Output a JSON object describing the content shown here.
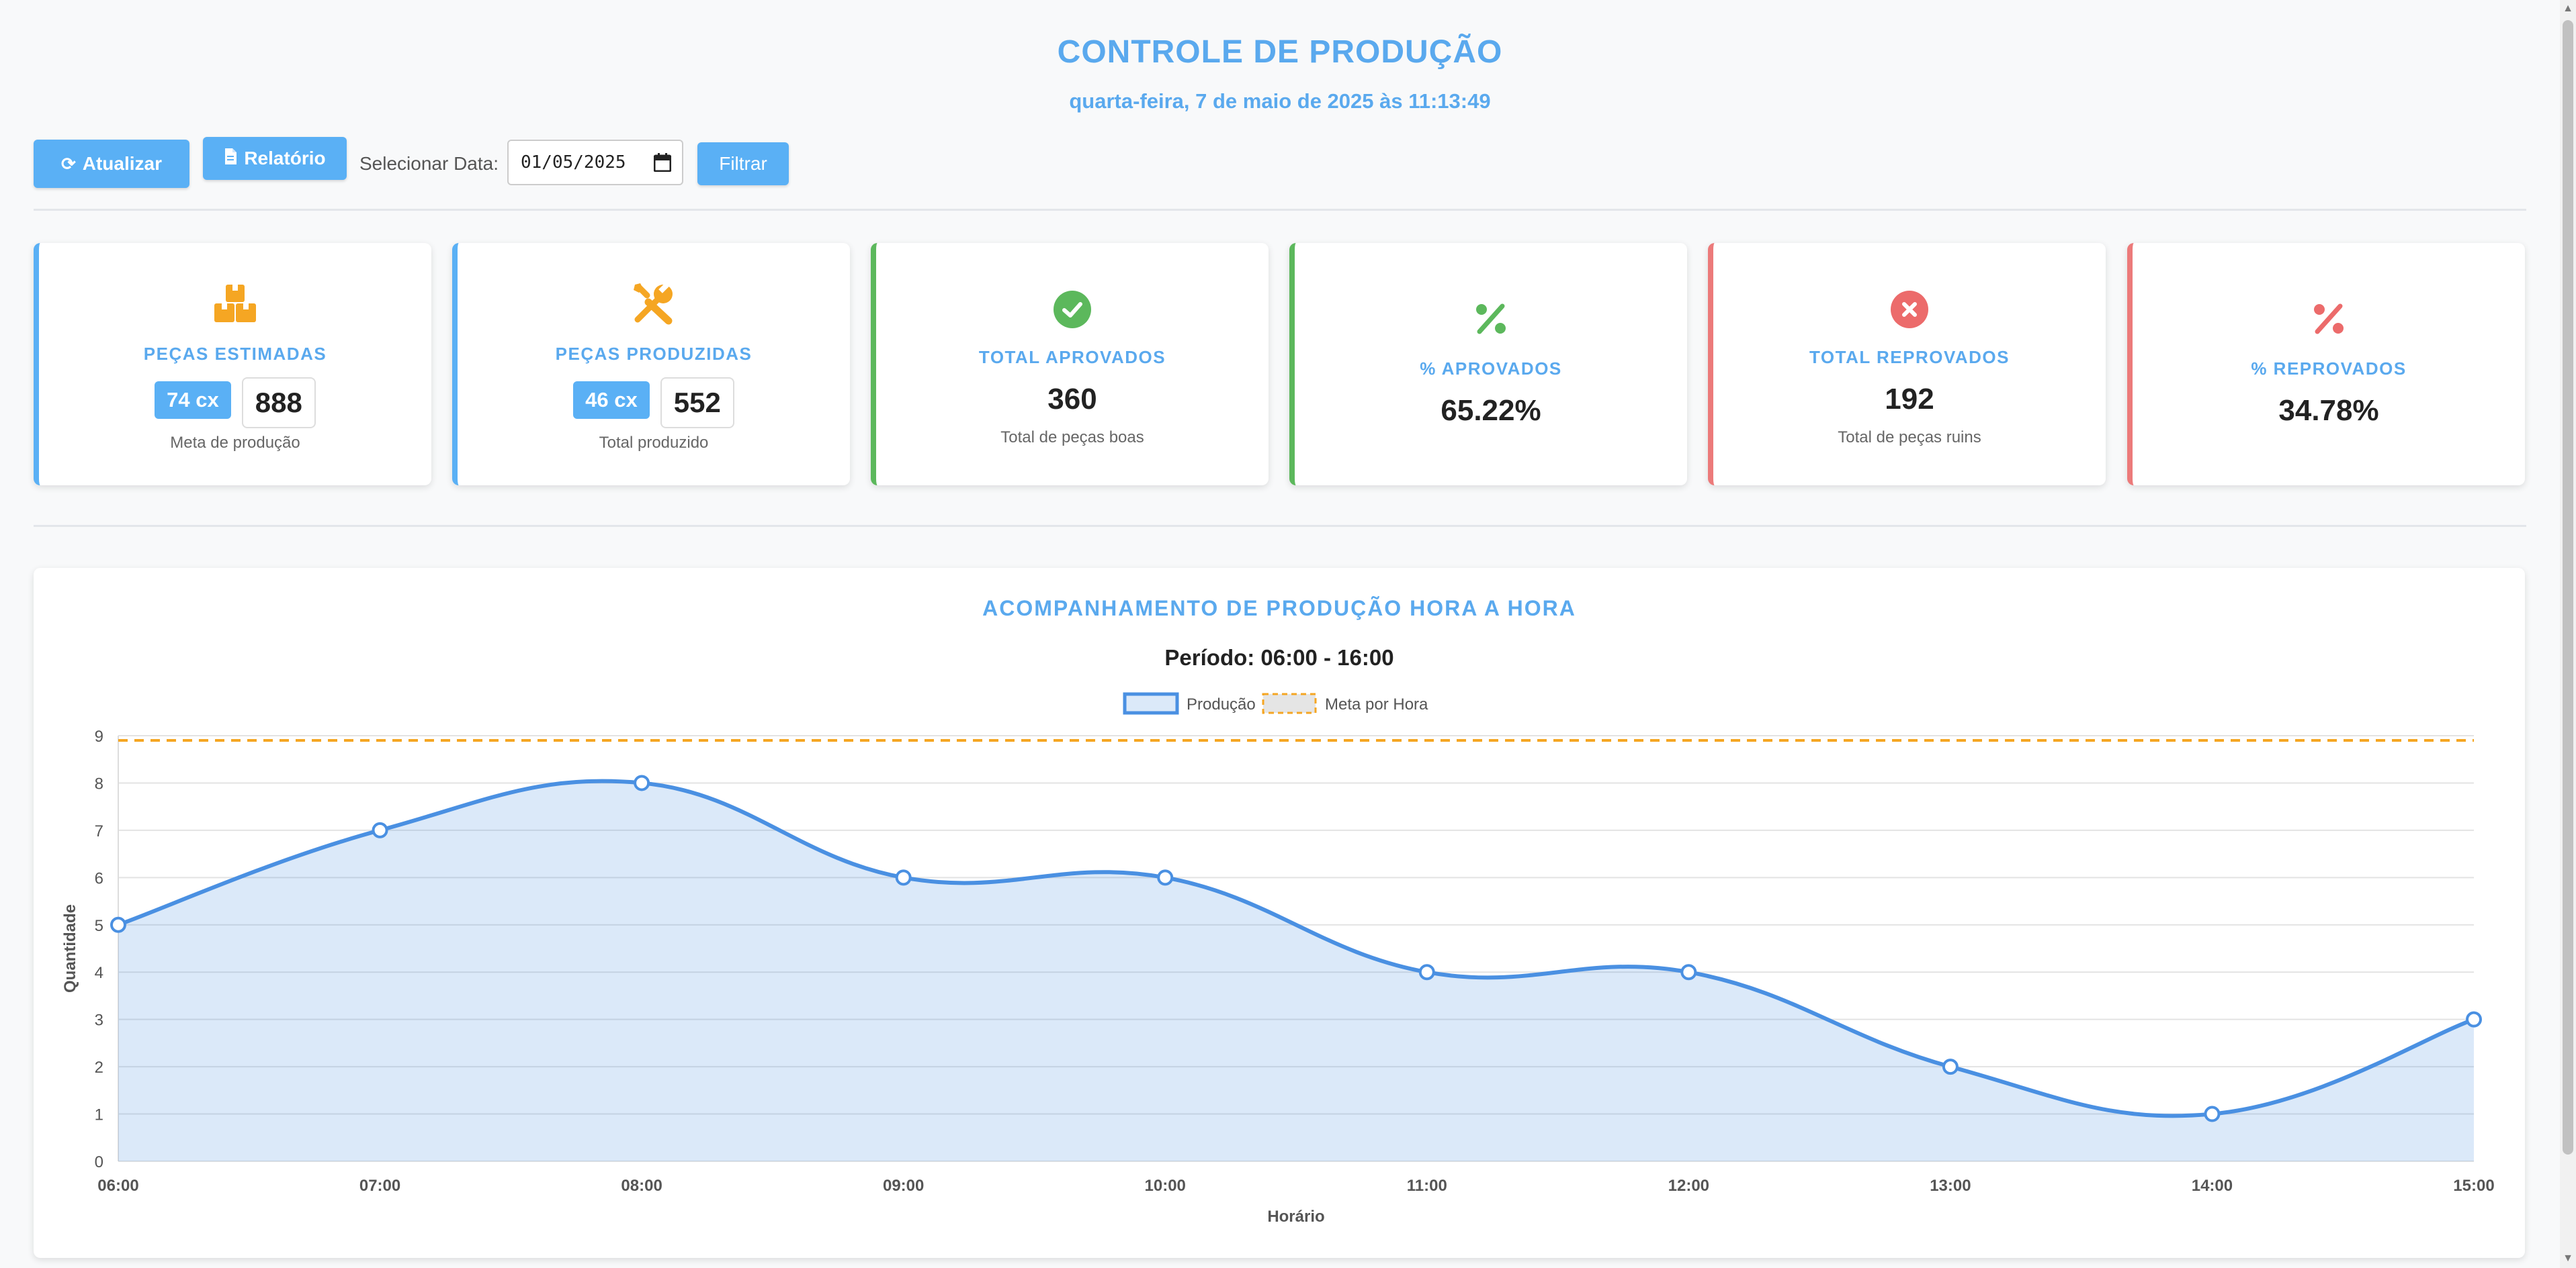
{
  "header": {
    "title": "CONTROLE DE PRODUÇÃO",
    "datetime": "quarta-feira, 7 de maio de 2025 às 11:13:49"
  },
  "toolbar": {
    "refresh_label": "Atualizar",
    "refresh_icon": "refresh-icon",
    "report_label": "Relatório",
    "report_icon": "file-icon",
    "date_label": "Selecionar Data:",
    "date_value": "01/05/2025",
    "filter_label": "Filtrar"
  },
  "cards": {
    "estimated": {
      "label": "PEÇAS ESTIMADAS",
      "boxes": "74 cx",
      "value": "888",
      "sub": "Meta de produção",
      "icon": "boxes-icon"
    },
    "produced": {
      "label": "PEÇAS PRODUZIDAS",
      "boxes": "46 cx",
      "value": "552",
      "sub": "Total produzido",
      "icon": "tools-icon"
    },
    "approved": {
      "label": "TOTAL APROVADOS",
      "value": "360",
      "sub": "Total de peças boas",
      "icon": "check-circle-icon"
    },
    "approved_pct": {
      "label": "% APROVADOS",
      "value": "65.22%",
      "icon": "percent-icon"
    },
    "rejected": {
      "label": "TOTAL REPROVADOS",
      "value": "192",
      "sub": "Total de peças ruins",
      "icon": "x-circle-icon"
    },
    "rejected_pct": {
      "label": "% REPROVADOS",
      "value": "34.78%",
      "icon": "percent-icon"
    }
  },
  "colors": {
    "accent": "#5ab0f5",
    "green": "#5cb85c",
    "red": "#ec7a7a",
    "orange": "#f5a623",
    "line": "#4a90e2"
  },
  "chart_section": {
    "title": "ACOMPANHAMENTO DE PRODUÇÃO HORA A HORA",
    "period": "Período: 06:00 - 16:00"
  },
  "chart_data": {
    "type": "area",
    "categories": [
      "06:00",
      "07:00",
      "08:00",
      "09:00",
      "10:00",
      "11:00",
      "12:00",
      "13:00",
      "14:00",
      "15:00"
    ],
    "series": [
      {
        "name": "Produção",
        "values": [
          5,
          7,
          8,
          6,
          6,
          4,
          4,
          2,
          1,
          3
        ]
      },
      {
        "name": "Meta por Hora",
        "values": [
          8.9,
          8.9,
          8.9,
          8.9,
          8.9,
          8.9,
          8.9,
          8.9,
          8.9,
          8.9
        ]
      }
    ],
    "xlabel": "Horário",
    "ylabel": "Quantidade",
    "ylim": [
      0,
      9
    ],
    "yticks": [
      "0",
      "1",
      "2",
      "3",
      "4",
      "5",
      "6",
      "7",
      "8",
      "9"
    ],
    "grid": true,
    "legend": "top-center"
  }
}
